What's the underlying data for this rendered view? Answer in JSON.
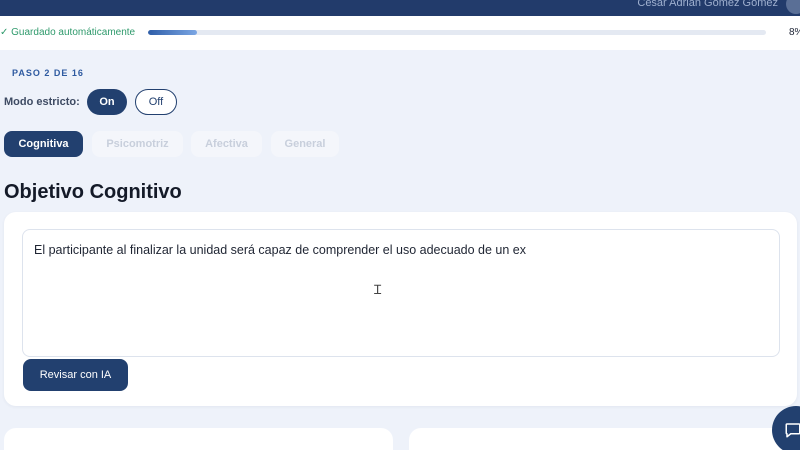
{
  "topbar": {
    "user_name": "César Adrián Gómez Gómez"
  },
  "savebar": {
    "status": "✓ Guardado automáticamente",
    "progress_percent": 8,
    "progress_label": "8%"
  },
  "step": {
    "label": "PASO 2 DE 16"
  },
  "strict_mode": {
    "label": "Modo estricto:",
    "on_label": "On",
    "off_label": "Off",
    "selected": "On"
  },
  "tabs": [
    {
      "label": "Cognitiva",
      "active": true
    },
    {
      "label": "Psicomotriz",
      "active": false
    },
    {
      "label": "Afectiva",
      "active": false
    },
    {
      "label": "General",
      "active": false
    }
  ],
  "main": {
    "title": "Objetivo Cognitivo",
    "objective_text": "El participante al finalizar la unidad será capaz de comprender el uso adecuado de un ex",
    "review_button": "Revisar con IA"
  },
  "colors": {
    "primary": "#22406f",
    "success": "#2f9a6c",
    "background": "#eef2fa"
  },
  "icons": {
    "chat": "chat-bubble-icon",
    "text_cursor": "text-cursor-icon"
  }
}
